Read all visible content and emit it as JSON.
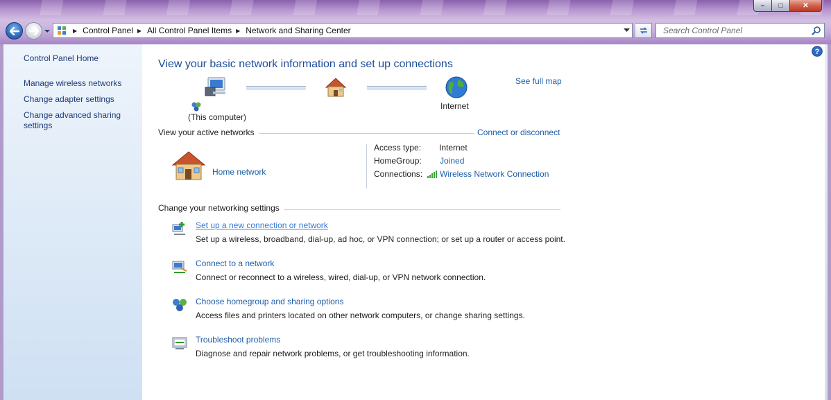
{
  "window": {
    "controls": {
      "minimize": "–",
      "maximize": "□",
      "close": "✕"
    }
  },
  "address": {
    "crumbs": [
      "Control Panel",
      "All Control Panel Items",
      "Network and Sharing Center"
    ]
  },
  "search": {
    "placeholder": "Search Control Panel"
  },
  "sidebar": {
    "home": "Control Panel Home",
    "items": [
      {
        "label": "Manage wireless networks"
      },
      {
        "label": "Change adapter settings"
      },
      {
        "label": "Change advanced sharing settings",
        "line1": "Change advanced sharing",
        "line2": "settings"
      }
    ]
  },
  "main": {
    "title": "View your basic network information and set up connections",
    "map": {
      "this_computer": "(This computer)",
      "internet": "Internet",
      "see_full_map": "See full map"
    },
    "active": {
      "heading": "View your active networks",
      "connect_link": "Connect or disconnect",
      "network_name": "Home network",
      "access_type_label": "Access type:",
      "access_type_value": "Internet",
      "homegroup_label": "HomeGroup:",
      "homegroup_value": "Joined",
      "connections_label": "Connections:",
      "connections_value": "Wireless Network Connection"
    },
    "settings": {
      "heading": "Change your networking settings",
      "tasks": [
        {
          "title": "Set up a new connection or network",
          "desc": "Set up a wireless, broadband, dial-up, ad hoc, or VPN connection; or set up a router or access point.",
          "icon": "new-connection-icon"
        },
        {
          "title": "Connect to a network",
          "desc": "Connect or reconnect to a wireless, wired, dial-up, or VPN network connection.",
          "icon": "connect-network-icon"
        },
        {
          "title": "Choose homegroup and sharing options",
          "desc": "Access files and printers located on other network computers, or change sharing settings.",
          "icon": "homegroup-icon"
        },
        {
          "title": "Troubleshoot problems",
          "desc": "Diagnose and repair network problems, or get troubleshooting information.",
          "icon": "troubleshoot-icon"
        }
      ]
    }
  }
}
